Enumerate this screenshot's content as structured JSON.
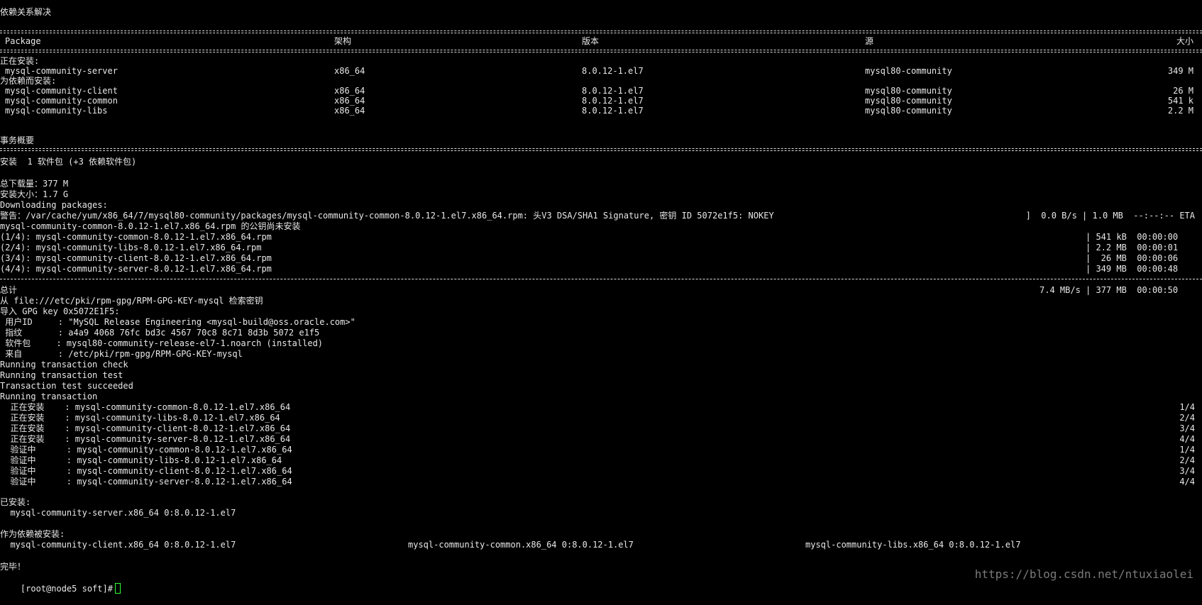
{
  "terminal": {
    "title_line": "依赖关系解决",
    "table_header": {
      "package": "Package",
      "arch": "架构",
      "version": "版本",
      "repo": "源",
      "size": "大小"
    },
    "installing_label": "正在安装:",
    "installing": [
      {
        "name": "mysql-community-server",
        "arch": "x86_64",
        "version": "8.0.12-1.el7",
        "repo": "mysql80-community",
        "size": "349 M"
      }
    ],
    "deps_label": "为依赖而安装:",
    "deps": [
      {
        "name": "mysql-community-client",
        "arch": "x86_64",
        "version": "8.0.12-1.el7",
        "repo": "mysql80-community",
        "size": "26 M"
      },
      {
        "name": "mysql-community-common",
        "arch": "x86_64",
        "version": "8.0.12-1.el7",
        "repo": "mysql80-community",
        "size": "541 k"
      },
      {
        "name": "mysql-community-libs",
        "arch": "x86_64",
        "version": "8.0.12-1.el7",
        "repo": "mysql80-community",
        "size": "2.2 M"
      }
    ],
    "summary_label": "事务概要",
    "summary_line": "安装  1 软件包 (+3 依赖软件包)",
    "total_download": "总下载量：377 M",
    "install_size": "安装大小：1.7 G",
    "downloading": "Downloading packages:",
    "warning_left": "警告：/var/cache/yum/x86_64/7/mysql80-community/packages/mysql-community-common-8.0.12-1.el7.x86_64.rpm: 头V3 DSA/SHA1 Signature, 密钥 ID 5072e1f5: NOKEY",
    "warning_right": "]  0.0 B/s | 1.0 MB  --:--:-- ETA",
    "pubkey_line": "mysql-community-common-8.0.12-1.el7.x86_64.rpm 的公钥尚未安装",
    "downloads": [
      {
        "left": "(1/4): mysql-community-common-8.0.12-1.el7.x86_64.rpm",
        "right": "| 541 kB  00:00:00"
      },
      {
        "left": "(2/4): mysql-community-libs-8.0.12-1.el7.x86_64.rpm",
        "right": "| 2.2 MB  00:00:01"
      },
      {
        "left": "(3/4): mysql-community-client-8.0.12-1.el7.x86_64.rpm",
        "right": "|  26 MB  00:00:06"
      },
      {
        "left": "(4/4): mysql-community-server-8.0.12-1.el7.x86_64.rpm",
        "right": "| 349 MB  00:00:48"
      }
    ],
    "total_left": "总计",
    "total_right": "7.4 MB/s | 377 MB  00:00:50",
    "key_retrieve": "从 file:///etc/pki/rpm-gpg/RPM-GPG-KEY-mysql 检索密钥",
    "import_key": "导入 GPG key 0x5072E1F5:",
    "key_details": [
      " 用户ID     : \"MySQL Release Engineering <mysql-build@oss.oracle.com>\"",
      " 指纹       : a4a9 4068 76fc bd3c 4567 70c8 8c71 8d3b 5072 e1f5",
      " 软件包     : mysql80-community-release-el7-1.noarch (installed)",
      " 来自       : /etc/pki/rpm-gpg/RPM-GPG-KEY-mysql"
    ],
    "transaction_lines": [
      "Running transaction check",
      "Running transaction test",
      "Transaction test succeeded",
      "Running transaction"
    ],
    "progress": [
      {
        "left": "  正在安装    : mysql-community-common-8.0.12-1.el7.x86_64",
        "right": "1/4"
      },
      {
        "left": "  正在安装    : mysql-community-libs-8.0.12-1.el7.x86_64",
        "right": "2/4"
      },
      {
        "left": "  正在安装    : mysql-community-client-8.0.12-1.el7.x86_64",
        "right": "3/4"
      },
      {
        "left": "  正在安装    : mysql-community-server-8.0.12-1.el7.x86_64",
        "right": "4/4"
      },
      {
        "left": "  验证中      : mysql-community-common-8.0.12-1.el7.x86_64",
        "right": "1/4"
      },
      {
        "left": "  验证中      : mysql-community-libs-8.0.12-1.el7.x86_64",
        "right": "2/4"
      },
      {
        "left": "  验证中      : mysql-community-client-8.0.12-1.el7.x86_64",
        "right": "3/4"
      },
      {
        "left": "  验证中      : mysql-community-server-8.0.12-1.el7.x86_64",
        "right": "4/4"
      }
    ],
    "installed_label": "已安装:",
    "installed_item": "  mysql-community-server.x86_64 0:8.0.12-1.el7",
    "dep_installed_label": "作为依赖被安装:",
    "dep_installed": [
      "  mysql-community-client.x86_64 0:8.0.12-1.el7",
      "mysql-community-common.x86_64 0:8.0.12-1.el7",
      "mysql-community-libs.x86_64 0:8.0.12-1.el7"
    ],
    "done": "完毕！",
    "prompt": "[root@node5 soft]#"
  },
  "watermark": "https://blog.csdn.net/ntuxiaolei"
}
